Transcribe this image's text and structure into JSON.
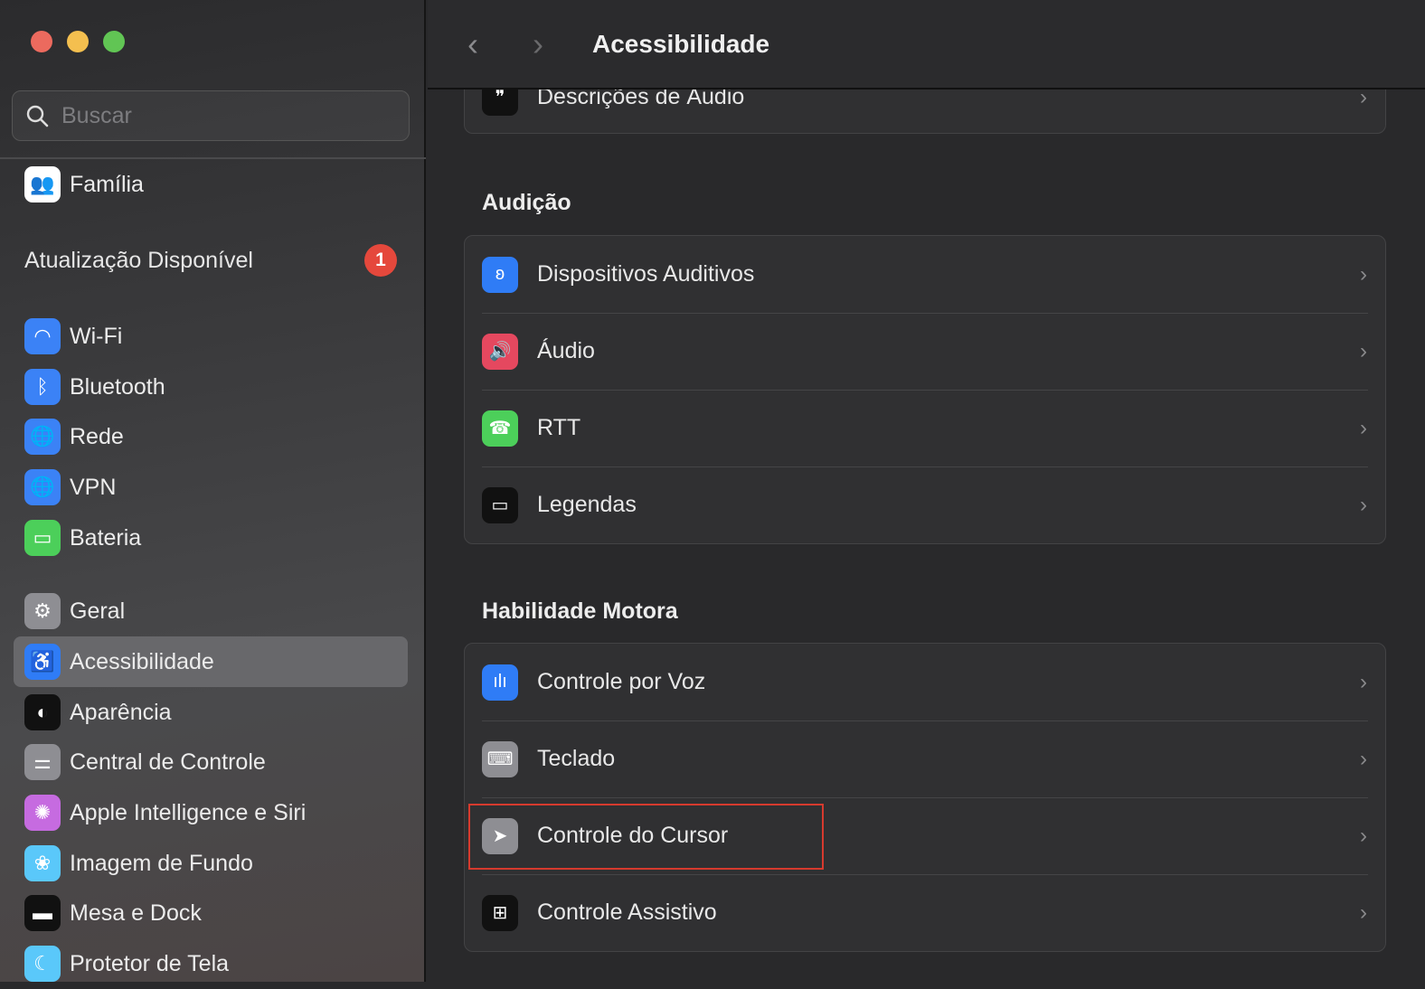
{
  "window": {
    "title": "Acessibilidade"
  },
  "sidebar": {
    "search_placeholder": "Buscar",
    "family": "Família",
    "update": {
      "label": "Atualização Disponível",
      "count": "1"
    },
    "items": [
      {
        "label": "Wi-Fi",
        "icon": "wifi-icon",
        "color": "#3b82f6"
      },
      {
        "label": "Bluetooth",
        "icon": "bluetooth-icon",
        "color": "#3b82f6"
      },
      {
        "label": "Rede",
        "icon": "globe-icon",
        "color": "#3b82f6"
      },
      {
        "label": "VPN",
        "icon": "vpn-globe-icon",
        "color": "#3b82f6"
      },
      {
        "label": "Bateria",
        "icon": "battery-icon",
        "color": "#4ccf5a"
      },
      {
        "label": "Geral",
        "icon": "gear-icon",
        "color": "#8e8e93"
      },
      {
        "label": "Acessibilidade",
        "icon": "accessibility-icon",
        "color": "#2f7cf6"
      },
      {
        "label": "Aparência",
        "icon": "appearance-icon",
        "color": "#111111"
      },
      {
        "label": "Central de Controle",
        "icon": "control-center-icon",
        "color": "#8e8e93"
      },
      {
        "label": "Apple Intelligence e Siri",
        "icon": "siri-icon",
        "color": "#c66be0"
      },
      {
        "label": "Imagem de Fundo",
        "icon": "wallpaper-icon",
        "color": "#5ac8fa"
      },
      {
        "label": "Mesa e Dock",
        "icon": "dock-icon",
        "color": "#111111"
      },
      {
        "label": "Protetor de Tela",
        "icon": "screensaver-icon",
        "color": "#5ac8fa"
      }
    ],
    "selected": "Acessibilidade"
  },
  "main": {
    "top_row": {
      "label": "Descrições de Áudio",
      "icon": "audio-descriptions-icon"
    },
    "sections": [
      {
        "title": "Audição",
        "rows": [
          {
            "label": "Dispositivos Auditivos",
            "icon": "ear-icon",
            "color": "#2f7cf6"
          },
          {
            "label": "Áudio",
            "icon": "speaker-icon",
            "color": "#e5485f"
          },
          {
            "label": "RTT",
            "icon": "rtt-phone-icon",
            "color": "#4ccf5a"
          },
          {
            "label": "Legendas",
            "icon": "captions-icon",
            "color": "#111111"
          }
        ]
      },
      {
        "title": "Habilidade Motora",
        "rows": [
          {
            "label": "Controle por Voz",
            "icon": "voice-control-icon",
            "color": "#2f7cf6"
          },
          {
            "label": "Teclado",
            "icon": "keyboard-icon",
            "color": "#8e8e93"
          },
          {
            "label": "Controle do Cursor",
            "icon": "pointer-icon",
            "color": "#8e8e93"
          },
          {
            "label": "Controle Assistivo",
            "icon": "switch-control-icon",
            "color": "#111111"
          }
        ]
      }
    ]
  }
}
